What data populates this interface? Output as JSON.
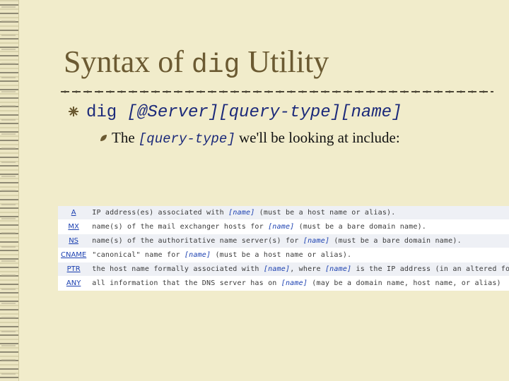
{
  "slide": {
    "title_prefix": "Syntax of ",
    "title_code": "dig",
    "title_suffix": " Utility"
  },
  "bullet1": {
    "cmd": "dig ",
    "args": "[@Server][query-type][name]"
  },
  "bullet2": {
    "prefix": "The ",
    "code": "[query-type]",
    "suffix": " we'll be looking at include:"
  },
  "query_types": [
    {
      "code": "A",
      "d1": "IP address(es) associated with ",
      "name": "[name]",
      "d2": " (must be a host name or alias).",
      "name2": "",
      "d3": ""
    },
    {
      "code": "MX",
      "d1": "name(s) of the mail exchanger hosts for ",
      "name": "[name]",
      "d2": " (must be a bare domain name).",
      "name2": "",
      "d3": ""
    },
    {
      "code": "NS",
      "d1": "name(s) of the authoritative name server(s) for ",
      "name": "[name]",
      "d2": " (must be a bare domain name).",
      "name2": "",
      "d3": ""
    },
    {
      "code": "CNAME",
      "d1": "\"canonical\" name for ",
      "name": "[name]",
      "d2": " (must be a host name or alias).",
      "name2": "",
      "d3": ""
    },
    {
      "code": "PTR",
      "d1": "the host name formally associated with ",
      "name": "[name]",
      "d2": ", where ",
      "name2": "[name]",
      "d3": " is the IP address (in an altered form)."
    },
    {
      "code": "ANY",
      "d1": "all information that the DNS server has on ",
      "name": "[name]",
      "d2": " (may be a domain name, host name, or alias)",
      "name2": "",
      "d3": ""
    }
  ],
  "colors": {
    "background": "#f1eccb",
    "title": "#6b5a32",
    "code_text": "#1c2a7a",
    "link": "#1a3fb0"
  },
  "icons": {
    "bullet1": "star-bullet-icon",
    "bullet2": "leaf-bullet-icon"
  }
}
